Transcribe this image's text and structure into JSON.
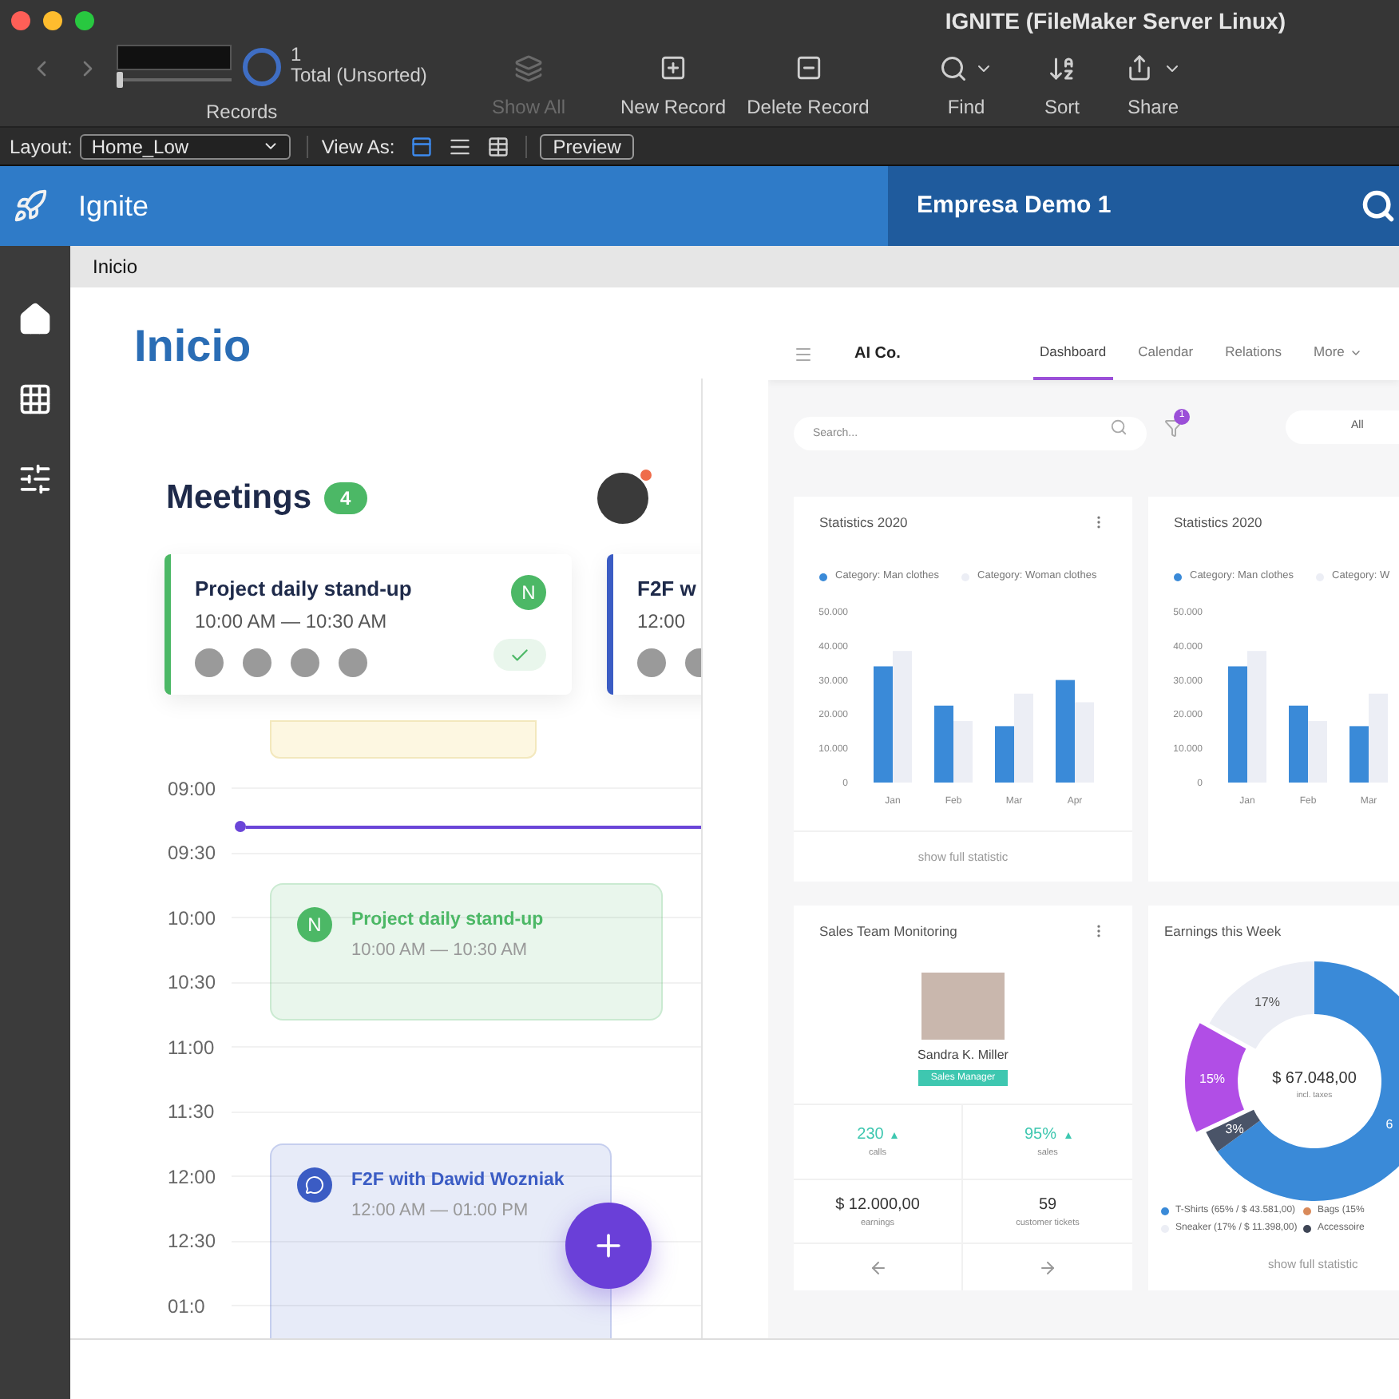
{
  "window": {
    "title": "IGNITE (FileMaker Server Linux)"
  },
  "toolbar": {
    "record_count": "1",
    "total": "Total (Unsorted)",
    "records_label": "Records",
    "slider": {
      "level": 0
    },
    "buttons": [
      {
        "label": "Show All",
        "kind": "show-all",
        "disabled": true
      },
      {
        "label": "New Record",
        "kind": "new",
        "disabled": false
      },
      {
        "label": "Delete Record",
        "kind": "delete",
        "disabled": false
      },
      {
        "label": "Find",
        "kind": "find",
        "disabled": false
      },
      {
        "label": "Sort",
        "kind": "sort",
        "disabled": false
      },
      {
        "label": "Share",
        "kind": "share",
        "disabled": false
      }
    ]
  },
  "layout_bar": {
    "layout_label": "Layout:",
    "layout_value": "Home_Low",
    "view_as_label": "View As:",
    "views": [
      {
        "kind": "form",
        "selected": true
      },
      {
        "kind": "list",
        "selected": false
      },
      {
        "kind": "table",
        "selected": false
      }
    ],
    "preview": "Preview"
  },
  "header": {
    "app_name": "Ignite",
    "company": "Empresa Demo 1"
  },
  "sidebar": {
    "items": [
      {
        "kind": "home"
      },
      {
        "kind": "grid"
      },
      {
        "kind": "sliders"
      }
    ]
  },
  "breadcrumb": "Inicio",
  "page_title": "Inicio",
  "mobile": {
    "title": "Meetings",
    "count": "4",
    "cards": [
      {
        "title": "Project daily stand-up",
        "time": "10:00 AM — 10:30 AM",
        "color": "#4cb866",
        "badge": "N",
        "done": true
      },
      {
        "title": "F2F w",
        "time": "12:00",
        "color": "#3b5cc4"
      }
    ],
    "hours": [
      "09:00",
      "09:30",
      "10:00",
      "10:30",
      "11:00",
      "11:30",
      "12:00",
      "12:30",
      "01:0"
    ],
    "events": [
      {
        "title": "Project daily stand-up",
        "time": "10:00 AM — 10:30 AM",
        "kind": "badge",
        "badge": "N",
        "color": "#4cb866"
      },
      {
        "title": "F2F with Dawid Wozniak",
        "time": "12:00 AM — 01:00 PM",
        "kind": "chat",
        "color": "#3b5cc4"
      }
    ]
  },
  "dashboard": {
    "brand": "AI Co.",
    "tabs": [
      {
        "label": "Dashboard",
        "selected": true
      },
      {
        "label": "Calendar",
        "selected": false
      },
      {
        "label": "Relations",
        "selected": false
      },
      {
        "label": "More",
        "selected": false
      }
    ],
    "search_placeholder": "Search...",
    "filter_count": "1",
    "segment": "All",
    "stat_cards": [
      {
        "title": "Statistics 2020",
        "footer": "show full statistic",
        "chart_data": {
          "type": "bar",
          "legend": true,
          "categories": [
            "Jan",
            "Feb",
            "Mar",
            "Apr"
          ],
          "ylim": [
            0,
            50000
          ],
          "series": [
            {
              "name": "Category: Man clothes",
              "color": "#3a8ad8",
              "values": [
                34000,
                22500,
                16500,
                30000
              ]
            },
            {
              "name": "Category: Woman clothes",
              "color": "#eceef5",
              "values": [
                38500,
                18000,
                26000,
                23500
              ]
            }
          ],
          "yticks": [
            {
              "value": 0,
              "label": "0"
            },
            {
              "value": 10000,
              "label": "10.000"
            },
            {
              "value": 20000,
              "label": "20.000"
            },
            {
              "value": 30000,
              "label": "30.000"
            },
            {
              "value": 40000,
              "label": "40.000"
            },
            {
              "value": 50000,
              "label": "50.000"
            }
          ]
        }
      },
      {
        "title": "Statistics 2020",
        "chart_data": {
          "type": "bar",
          "legend": true,
          "categories": [
            "Jan",
            "Feb",
            "Mar"
          ],
          "ylim": [
            0,
            50000
          ],
          "series": [
            {
              "name": "Category: Man clothes",
              "color": "#3a8ad8",
              "values": [
                34000,
                22500,
                16500
              ]
            },
            {
              "name": "Category: W",
              "color": "#eceef5",
              "values": [
                38500,
                18000,
                26000
              ]
            }
          ],
          "yticks": [
            {
              "value": 0,
              "label": "0"
            },
            {
              "value": 10000,
              "label": "10.000"
            },
            {
              "value": 20000,
              "label": "20.000"
            },
            {
              "value": 30000,
              "label": "30.000"
            },
            {
              "value": 40000,
              "label": "40.000"
            },
            {
              "value": 50000,
              "label": "50.000"
            }
          ]
        }
      }
    ],
    "sales": {
      "title": "Sales Team Monitoring",
      "name": "Sandra K. Miller",
      "role": "Sales Manager",
      "stats": [
        {
          "value": "230",
          "label": "calls",
          "kind": "trend"
        },
        {
          "value": "95%",
          "label": "sales",
          "kind": "trend"
        },
        {
          "value": "$ 12.000,00",
          "label": "earnings",
          "kind": "plain"
        },
        {
          "value": "59",
          "label": "customer tickets",
          "kind": "plain"
        }
      ]
    },
    "earnings": {
      "title": "Earnings this Week",
      "total": "$ 67.048,00",
      "note": "incl. taxes",
      "footer": "show full statistic",
      "chart_data": {
        "type": "donut",
        "values": [
          65,
          3,
          15,
          17
        ]
      },
      "slices": [
        {
          "label": "6",
          "color": "#3a8ad8",
          "exploded": false
        },
        {
          "label": "3%",
          "color": "#4a5468",
          "exploded": false
        },
        {
          "label": "15%",
          "color": "#b14ee6",
          "exploded": true
        },
        {
          "label": "17%",
          "color": "#eceef5",
          "exploded": false
        }
      ],
      "legend": [
        {
          "label": "T-Shirts (65% / $ 43.581,00)",
          "color": "#3a8ad8"
        },
        {
          "label": "Bags (15%",
          "color": "#d98a5a"
        },
        {
          "label": "Sneaker (17% / $ 11.398,00)",
          "color": "#eceef5"
        },
        {
          "label": "Accessoire",
          "color": "#3f4656"
        }
      ]
    }
  }
}
